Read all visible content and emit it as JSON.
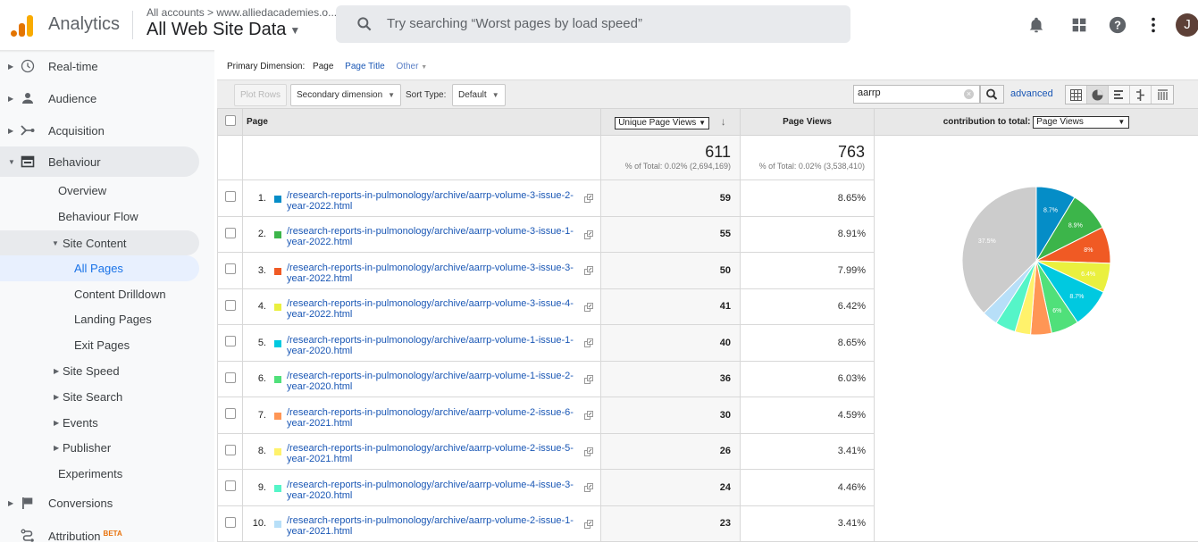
{
  "header": {
    "app_title": "Analytics",
    "account_path": "All accounts > www.alliedacademies.o...",
    "property": "All Web Site Data",
    "search_placeholder": "Try searching “Worst pages by load speed”",
    "avatar_letter": "J",
    "icons": [
      "bell-icon",
      "apps-grid-icon",
      "help-icon",
      "more-vert-icon"
    ]
  },
  "sidebar": {
    "items": [
      {
        "label": "Real-time",
        "icon": "clock-icon"
      },
      {
        "label": "Audience",
        "icon": "person-icon"
      },
      {
        "label": "Acquisition",
        "icon": "acquisition-icon"
      },
      {
        "label": "Behaviour",
        "icon": "behaviour-icon"
      },
      {
        "label": "Overview"
      },
      {
        "label": "Behaviour Flow"
      },
      {
        "label": "Site Content"
      },
      {
        "label": "All Pages"
      },
      {
        "label": "Content Drilldown"
      },
      {
        "label": "Landing Pages"
      },
      {
        "label": "Exit Pages"
      },
      {
        "label": "Site Speed"
      },
      {
        "label": "Site Search"
      },
      {
        "label": "Events"
      },
      {
        "label": "Publisher"
      },
      {
        "label": "Experiments"
      },
      {
        "label": "Conversions",
        "icon": "flag-icon"
      },
      {
        "label": "Attribution",
        "icon": "attribution-icon",
        "badge": "BETA"
      }
    ]
  },
  "report": {
    "primary_dimension_label": "Primary Dimension:",
    "dims": [
      "Page",
      "Page Title",
      "Other"
    ],
    "plot_rows": "Plot Rows",
    "secondary_dimension": "Secondary dimension",
    "sort_type_label": "Sort Type:",
    "sort_type_value": "Default",
    "filter_value": "aarrp",
    "advanced": "advanced",
    "columns": {
      "page": "Page",
      "metric1": "Unique Page Views",
      "metric2": "Page Views",
      "contribution_label": "contribution to total:",
      "contribution_value": "Page Views"
    },
    "totals": {
      "metric1": "611",
      "metric1_sub": "% of Total: 0.02% (2,694,169)",
      "metric2": "763",
      "metric2_sub": "% of Total: 0.02% (3,538,410)"
    },
    "rows": [
      {
        "idx": "1.",
        "color": "#058dc7",
        "page": "/research-reports-in-pulmonology/archive/aarrp-volume-3-issue-2-year-2022.html",
        "upv": "59",
        "pv": "8.65%"
      },
      {
        "idx": "2.",
        "color": "#3cb54a",
        "page": "/research-reports-in-pulmonology/archive/aarrp-volume-3-issue-1-year-2022.html",
        "upv": "55",
        "pv": "8.91%"
      },
      {
        "idx": "3.",
        "color": "#f05a24",
        "page": "/research-reports-in-pulmonology/archive/aarrp-volume-3-issue-3-year-2022.html",
        "upv": "50",
        "pv": "7.99%"
      },
      {
        "idx": "4.",
        "color": "#eaf03f",
        "page": "/research-reports-in-pulmonology/archive/aarrp-volume-3-issue-4-year-2022.html",
        "upv": "41",
        "pv": "6.42%"
      },
      {
        "idx": "5.",
        "color": "#00c9e0",
        "page": "/research-reports-in-pulmonology/archive/aarrp-volume-1-issue-1-year-2020.html",
        "upv": "40",
        "pv": "8.65%"
      },
      {
        "idx": "6.",
        "color": "#50e07a",
        "page": "/research-reports-in-pulmonology/archive/aarrp-volume-1-issue-2-year-2020.html",
        "upv": "36",
        "pv": "6.03%"
      },
      {
        "idx": "7.",
        "color": "#ff9655",
        "page": "/research-reports-in-pulmonology/archive/aarrp-volume-2-issue-6-year-2021.html",
        "upv": "30",
        "pv": "4.59%"
      },
      {
        "idx": "8.",
        "color": "#fff26b",
        "page": "/research-reports-in-pulmonology/archive/aarrp-volume-2-issue-5-year-2021.html",
        "upv": "26",
        "pv": "3.41%"
      },
      {
        "idx": "9.",
        "color": "#55f5c8",
        "page": "/research-reports-in-pulmonology/archive/aarrp-volume-4-issue-3-year-2020.html",
        "upv": "24",
        "pv": "4.46%"
      },
      {
        "idx": "10.",
        "color": "#b7dff8",
        "page": "/research-reports-in-pulmonology/archive/aarrp-volume-2-issue-1-year-2021.html",
        "upv": "23",
        "pv": "3.41%"
      }
    ]
  },
  "chart_data": {
    "type": "pie",
    "title": "contribution to total: Page Views",
    "slices": [
      {
        "label": "1",
        "value": 8.65,
        "display": "8.7%",
        "color": "#058dc7"
      },
      {
        "label": "2",
        "value": 8.91,
        "display": "8.9%",
        "color": "#3cb54a"
      },
      {
        "label": "3",
        "value": 7.99,
        "display": "8%",
        "color": "#f05a24"
      },
      {
        "label": "4",
        "value": 6.42,
        "display": "6.4%",
        "color": "#eaf03f"
      },
      {
        "label": "5",
        "value": 8.65,
        "display": "8.7%",
        "color": "#00c9e0"
      },
      {
        "label": "6",
        "value": 6.03,
        "display": "6%",
        "color": "#50e07a"
      },
      {
        "label": "7",
        "value": 4.59,
        "display": "",
        "color": "#ff9655"
      },
      {
        "label": "8",
        "value": 3.41,
        "display": "",
        "color": "#fff26b"
      },
      {
        "label": "9",
        "value": 4.46,
        "display": "",
        "color": "#55f5c8"
      },
      {
        "label": "10",
        "value": 3.41,
        "display": "",
        "color": "#b7dff8"
      },
      {
        "label": "Other",
        "value": 37.48,
        "display": "37.5%",
        "color": "#cccccc"
      }
    ]
  }
}
